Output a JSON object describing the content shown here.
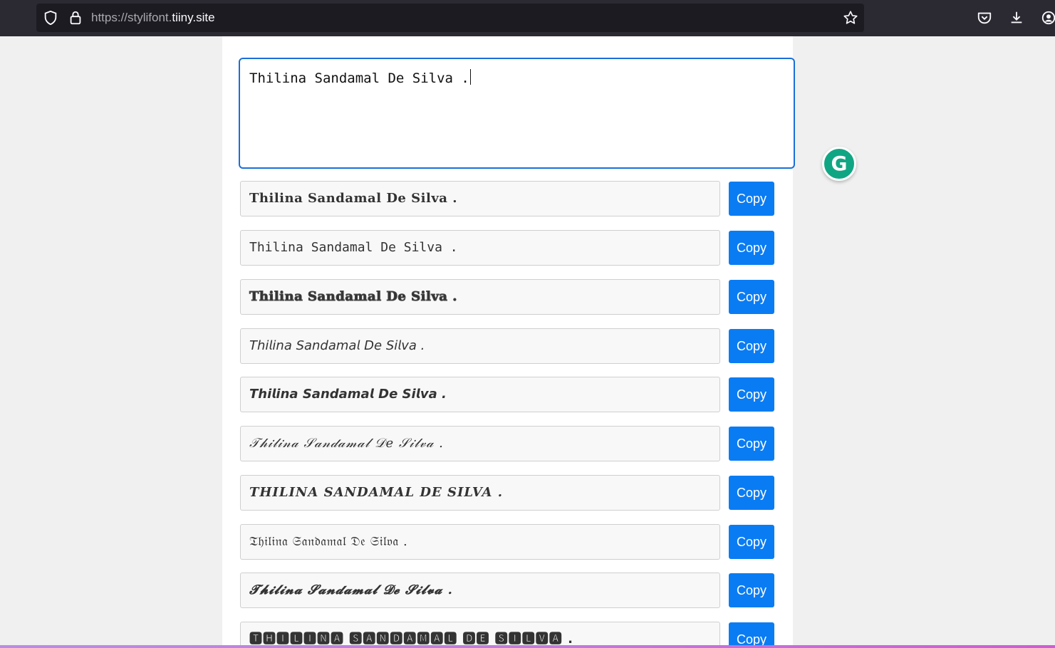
{
  "browser": {
    "url_prefix": "https://stylifont.",
    "url_host": "tiiny.site"
  },
  "editor": {
    "text": "Thilina Sandamal De Silva ."
  },
  "grammarly_badge": "G",
  "copy_label": "Copy",
  "outputs": [
    "𝐓𝐡𝐢𝐥𝐢𝐧𝐚 𝐒𝐚𝐧𝐝𝐚𝐦𝐚𝐥 𝐃𝐞 𝐒𝐢𝐥𝐯𝐚 .",
    "𝚃𝚑𝚒𝚕𝚒𝚗𝚊 𝚂𝚊𝚗𝚍𝚊𝚖𝚊𝚕 𝙳𝚎 𝚂𝚒𝚕𝚟𝚊 .",
    "Thilina Sandamal De Silva .",
    "𝘛𝘩𝘪𝘭𝘪𝘯𝘢 𝘚𝘢𝘯𝘥𝘢𝘮𝘢𝘭 𝘋𝘦 𝘚𝘪𝘭𝘷𝘢 .",
    "𝙏𝙝𝙞𝙡𝙞𝙣𝙖 𝙎𝙖𝙣𝙙𝙖𝙢𝙖𝙡 𝘿𝙚 𝙎𝙞𝙡𝙫𝙖 .",
    "𝒯𝒽𝒾𝓁𝒾𝓃𝒶 𝒮𝒶𝓃𝒹𝒶𝓂𝒶𝓁 𝒟𝑒 𝒮𝒾𝓁𝓋𝒶 .",
    "THILINA SANDAMAL DE SILVA .",
    "𝔗𝔥𝔦𝔩𝔦𝔫𝔞 𝔖𝔞𝔫𝔡𝔞𝔪𝔞𝔩 𝔇𝔢 𝔖𝔦𝔩𝔳𝔞 .",
    "𝓣𝓱𝓲𝓵𝓲𝓷𝓪 𝓢𝓪𝓷𝓭𝓪𝓶𝓪𝓵 𝓓𝓮 𝓢𝓲𝓵𝓿𝓪 .",
    "🆃🅷🅸🅻🅸🅽🅰 🆂🅰🅽🅳🅰🅼🅰🅻 🅳🅴 🆂🅸🅻🆅🅰 ."
  ],
  "colors": {
    "copy_button": "#0a7cf3",
    "focus_border": "#1a6fd8",
    "grammarly": "#11a683",
    "browser_bar": "#2b2a33"
  }
}
